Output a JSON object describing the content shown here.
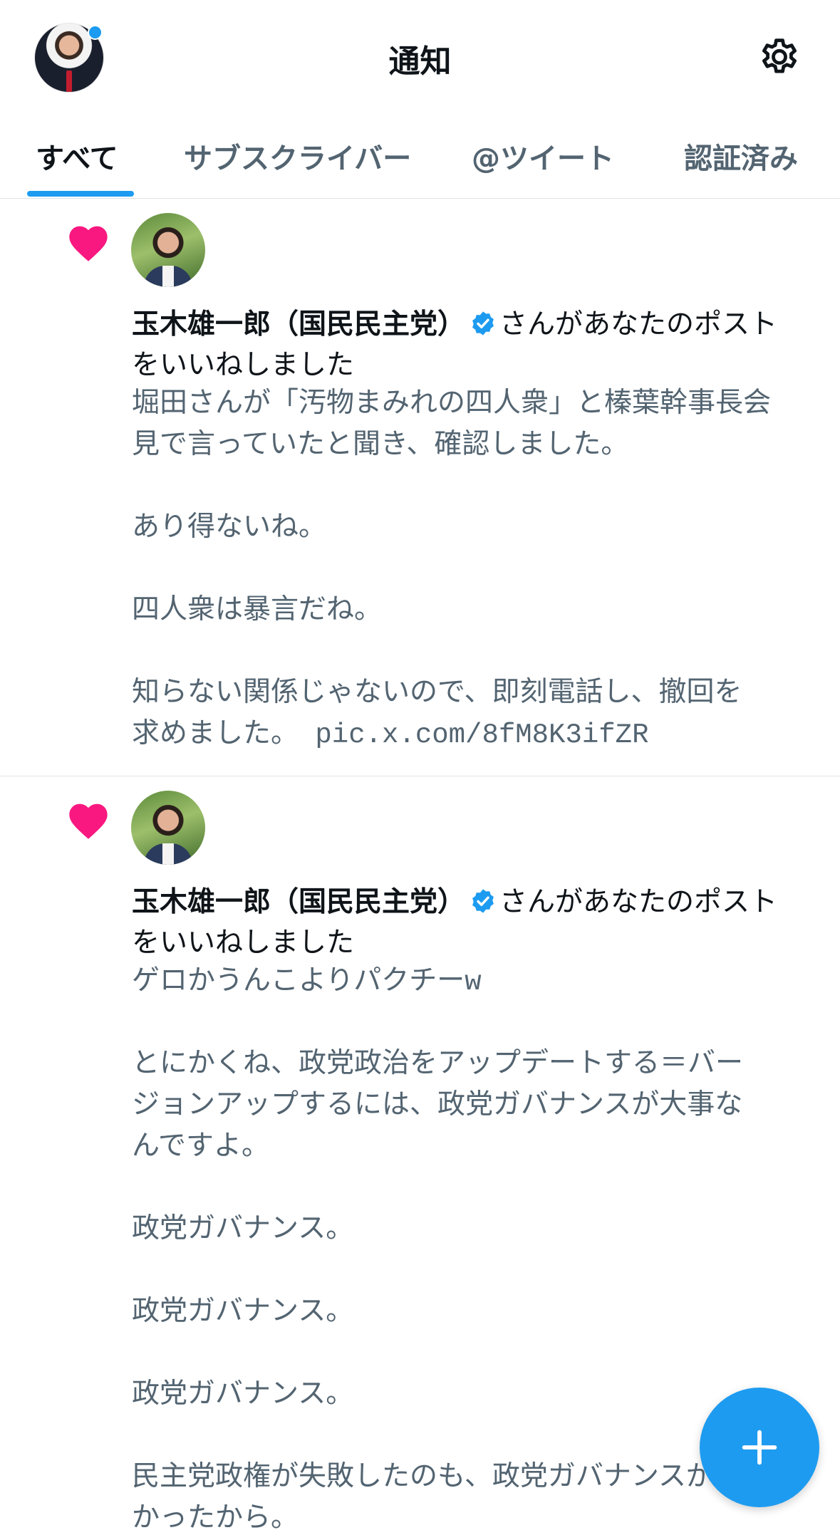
{
  "header": {
    "title": "通知"
  },
  "tabs": [
    {
      "label": "すべて",
      "active": true
    },
    {
      "label": "サブスクライバー",
      "active": false
    },
    {
      "label": "@ツイート",
      "active": false
    },
    {
      "label": "認証済み",
      "active": false
    }
  ],
  "notifications": [
    {
      "type": "like",
      "liker_name": "玉木雄一郎（国民民主党）",
      "action": "さんがあなたのポスト",
      "action_line2": "をいいねしました",
      "text": "堀田さんが「汚物まみれの四人衆」と榛葉幹事長会\n見で言っていたと聞き、確認しました。\n\nあり得ないね。\n\n四人衆は暴言だね。\n\n知らない関係じゃないので、即刻電話し、撤回を\n求めました。 pic.x.com/8fM8K3ifZR"
    },
    {
      "type": "like",
      "liker_name": "玉木雄一郎（国民民主党）",
      "action": "さんがあなたのポスト",
      "action_line2": "をいいねしました",
      "text": "ゲロかうんこよりパクチーw\n\nとにかくね、政党政治をアップデートする＝バー\nジョンアップするには、政党ガバナンスが大事な\nんですよ。\n\n政党ガバナンス。\n\n政党ガバナンス。\n\n政党ガバナンス。\n\n民主党政権が失敗したのも、政党ガバナンスがな\nかったから。"
    }
  ],
  "colors": {
    "accent": "#1d9bf0",
    "heart": "#f91880",
    "secondary_text": "#536471"
  },
  "icons": {
    "settings": "gear-icon",
    "like": "heart-icon",
    "verified": "verified-badge-icon",
    "compose": "plus-icon"
  }
}
